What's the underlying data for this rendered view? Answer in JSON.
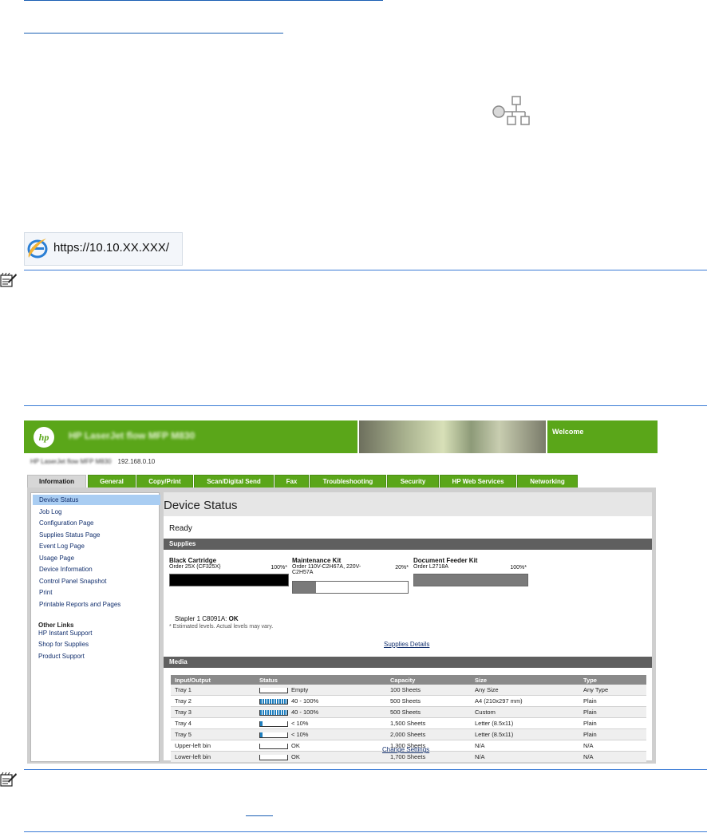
{
  "address_bar": {
    "url": "https://10.10.XX.XXX/"
  },
  "ews": {
    "banner_title": "HP LaserJet flow MFP M830",
    "logo_text": "hp",
    "welcome": "Welcome",
    "model_name": "HP LaserJet flow MFP M830",
    "ip": "192.168.0.10",
    "tabs": [
      "Information",
      "General",
      "Copy/Print",
      "Scan/Digital Send",
      "Fax",
      "Troubleshooting",
      "Security",
      "HP Web Services",
      "Networking"
    ],
    "sidebar": {
      "items": [
        "Device Status",
        "Job Log",
        "Configuration Page",
        "Supplies Status Page",
        "Event Log Page",
        "Usage Page",
        "Device Information",
        "Control Panel Snapshot",
        "Print",
        "Printable Reports and Pages"
      ],
      "other_links_heading": "Other Links",
      "other_links": [
        "HP Instant Support",
        "Shop for Supplies",
        "Product Support"
      ]
    },
    "page_title": "Device Status",
    "status": "Ready",
    "supplies_heading": "Supplies",
    "supplies": [
      {
        "name": "Black Cartridge",
        "order": "Order 25X (CF325X)",
        "level": "100%*",
        "fill": 1.0,
        "color": "#000000"
      },
      {
        "name": "Maintenance Kit",
        "order": "Order 110V-C2H67A, 220V-C2H57A",
        "level": "20%*",
        "fill": 0.2,
        "color": "#7a7a7a"
      },
      {
        "name": "Document Feeder Kit",
        "order": "Order L2718A",
        "level": "100%*",
        "fill": 1.0,
        "color": "#7a7a7a"
      }
    ],
    "stapler_label": "Stapler 1 C8091A:",
    "stapler_status": "OK",
    "estimate_note": "* Estimated levels. Actual levels may vary.",
    "supplies_details_link": "Supplies Details",
    "media_heading": "Media",
    "media_columns": [
      "Input/Output",
      "Status",
      "Capacity",
      "Size",
      "Type"
    ],
    "media_rows": [
      {
        "io": "Tray 1",
        "status": "Empty",
        "fill": 0.0,
        "capacity": "100 Sheets",
        "size": "Any Size",
        "type": "Any Type"
      },
      {
        "io": "Tray 2",
        "status": "40 - 100%",
        "fill": 1.0,
        "capacity": "500 Sheets",
        "size": "A4 (210x297 mm)",
        "type": "Plain"
      },
      {
        "io": "Tray 3",
        "status": "40 - 100%",
        "fill": 1.0,
        "capacity": "500 Sheets",
        "size": "Custom",
        "type": "Plain"
      },
      {
        "io": "Tray 4",
        "status": "< 10%",
        "fill": 0.08,
        "capacity": "1,500 Sheets",
        "size": "Letter (8.5x11)",
        "type": "Plain"
      },
      {
        "io": "Tray 5",
        "status": "< 10%",
        "fill": 0.08,
        "capacity": "2,000 Sheets",
        "size": "Letter (8.5x11)",
        "type": "Plain"
      },
      {
        "io": "Upper-left bin",
        "status": "OK",
        "fill": 0.0,
        "capacity": "1,300 Sheets",
        "size": "N/A",
        "type": "N/A"
      },
      {
        "io": "Lower-left bin",
        "status": "OK",
        "fill": 0.0,
        "capacity": "1,700 Sheets",
        "size": "N/A",
        "type": "N/A"
      }
    ],
    "change_settings_link": "Change Settings"
  },
  "icons": [
    "network-icon",
    "note-icon",
    "ie-browser-icon",
    "hp-logo"
  ]
}
